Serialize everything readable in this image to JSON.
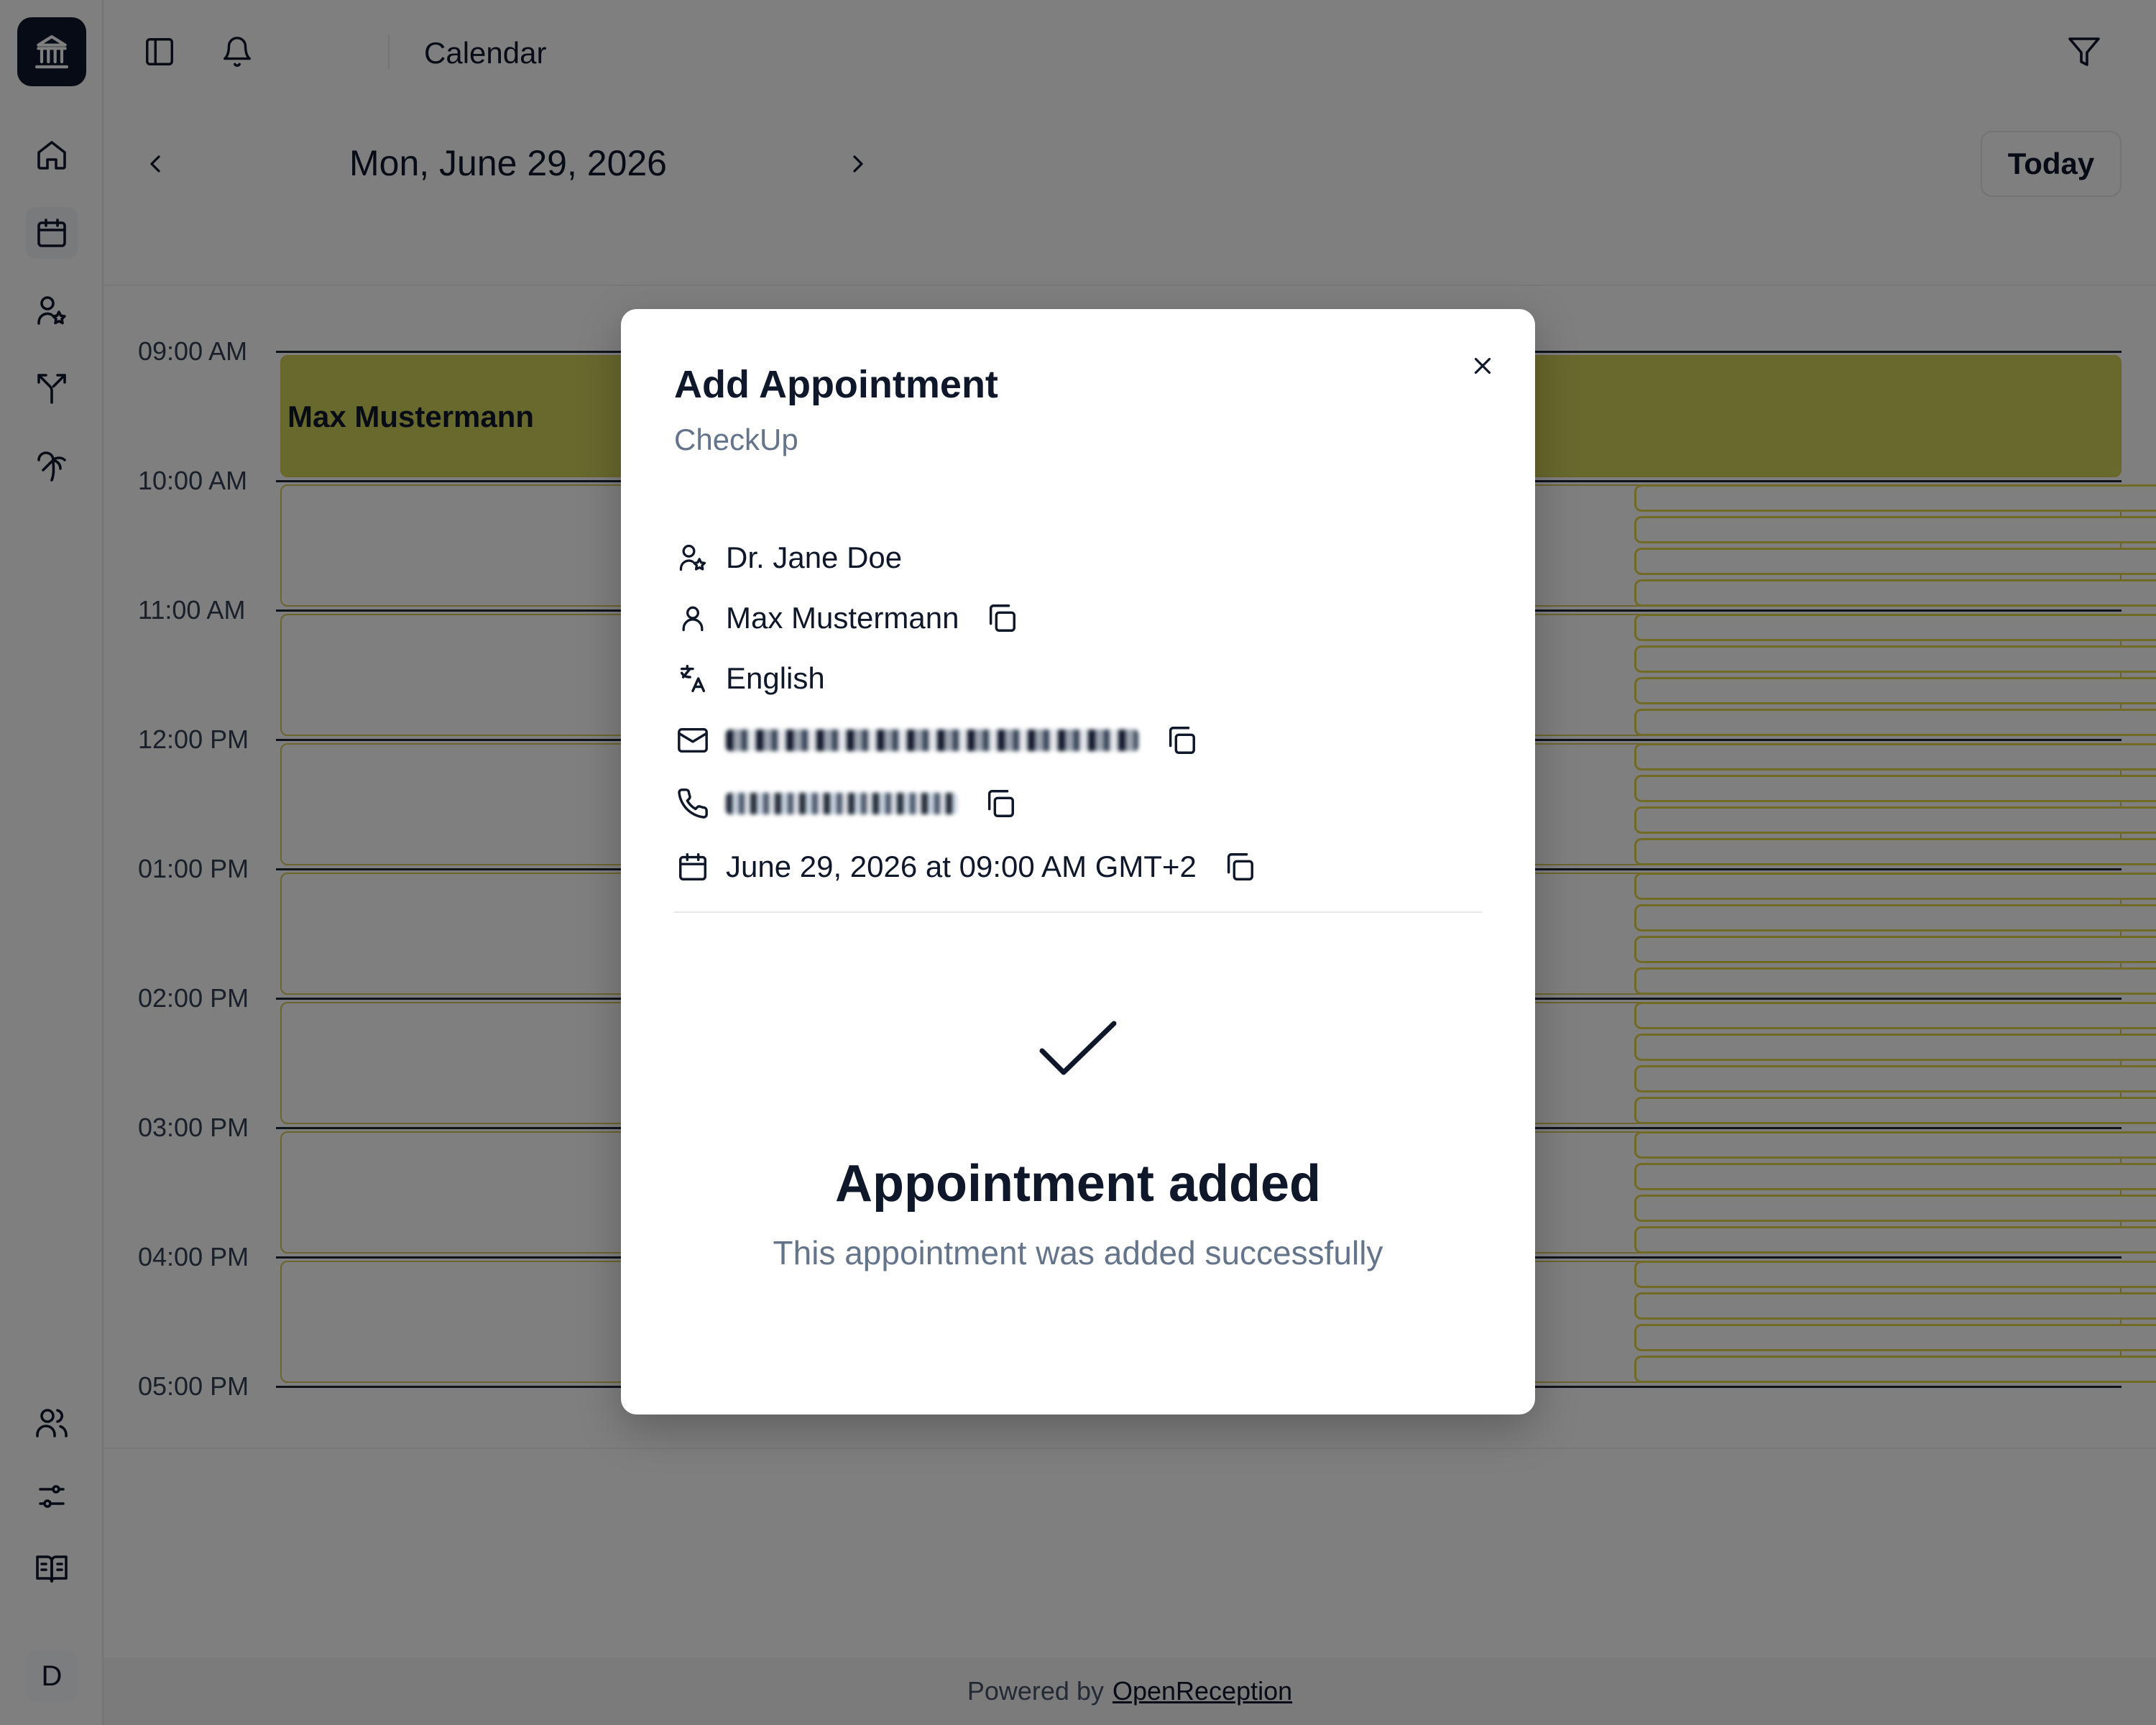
{
  "app": {
    "title": "Calendar",
    "sidebar_user_initial": "D",
    "footer_prefix": "Powered by",
    "footer_link": "OpenReception"
  },
  "toolbar": {
    "date": "Mon, June 29, 2026",
    "today_label": "Today"
  },
  "calendar": {
    "time_labels": [
      "09:00 AM",
      "10:00 AM",
      "11:00 AM",
      "12:00 PM",
      "01:00 PM",
      "02:00 PM",
      "03:00 PM",
      "04:00 PM",
      "05:00 PM"
    ],
    "booked_name": "Max Mustermann"
  },
  "modal": {
    "title": "Add Appointment",
    "subtitle": "CheckUp",
    "doctor": "Dr. Jane Doe",
    "patient": "Max Mustermann",
    "language": "English",
    "datetime": "June 29, 2026 at 09:00 AM GMT+2",
    "success_title": "Appointment added",
    "success_message": "This appointment was added successfully"
  },
  "icons": {
    "logo": "bank-icon",
    "home": "home-icon",
    "calendar": "calendar-icon",
    "staff": "user-star-icon",
    "routes": "split-arrow-icon",
    "vacation": "palm-tree-icon",
    "users": "users-icon",
    "settings": "sliders-icon",
    "docs": "book-open-icon",
    "filter": "filter-icon",
    "notifications": "bell-icon",
    "panel": "sidebar-toggle-icon"
  },
  "colors": {
    "booked_slot": "#d1d35b",
    "slot_border": "#d6c95a",
    "primary_text": "#0f172a",
    "muted_text": "#64748b"
  }
}
